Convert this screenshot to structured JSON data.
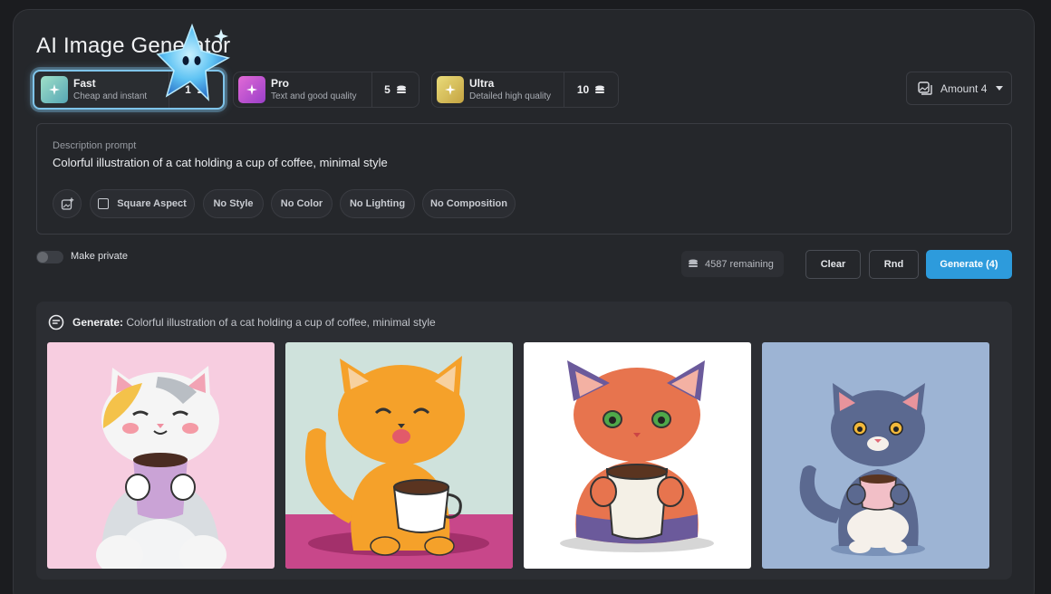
{
  "header": {
    "title": "AI Image Generator"
  },
  "tiers": [
    {
      "name": "Fast",
      "desc": "Cheap and instant",
      "cost": "1",
      "color": "#7fc9b2",
      "active": true
    },
    {
      "name": "Pro",
      "desc": "Text and good quality",
      "cost": "5",
      "color": "#c254c9",
      "active": false
    },
    {
      "name": "Ultra",
      "desc": "Detailed high quality",
      "cost": "10",
      "color": "#d7c25d",
      "active": false
    }
  ],
  "amount": {
    "label": "Amount 4"
  },
  "prompt": {
    "label": "Description prompt",
    "value": "Colorful illustration of a cat holding a cup of coffee, minimal style"
  },
  "chips": [
    "Square Aspect",
    "No Style",
    "No Color",
    "No Lighting",
    "No Composition"
  ],
  "privacy": {
    "label": "Make private",
    "on": false
  },
  "credits": {
    "remaining": "4587 remaining"
  },
  "actions": {
    "clear": "Clear",
    "random": "Rnd",
    "generate": "Generate (4)"
  },
  "results": {
    "heading": "Generate:",
    "prompt": "Colorful illustration of a cat holding a cup of coffee, minimal style",
    "images": [
      {
        "bg": "#f7cde0"
      },
      {
        "bg": "#cfe2dc"
      },
      {
        "bg": "#ffffff"
      },
      {
        "bg": "#9db4d4"
      }
    ]
  },
  "colors": {
    "accent": "#2d9bdc",
    "panel": "#25272b",
    "page": "#1b1c1f"
  }
}
